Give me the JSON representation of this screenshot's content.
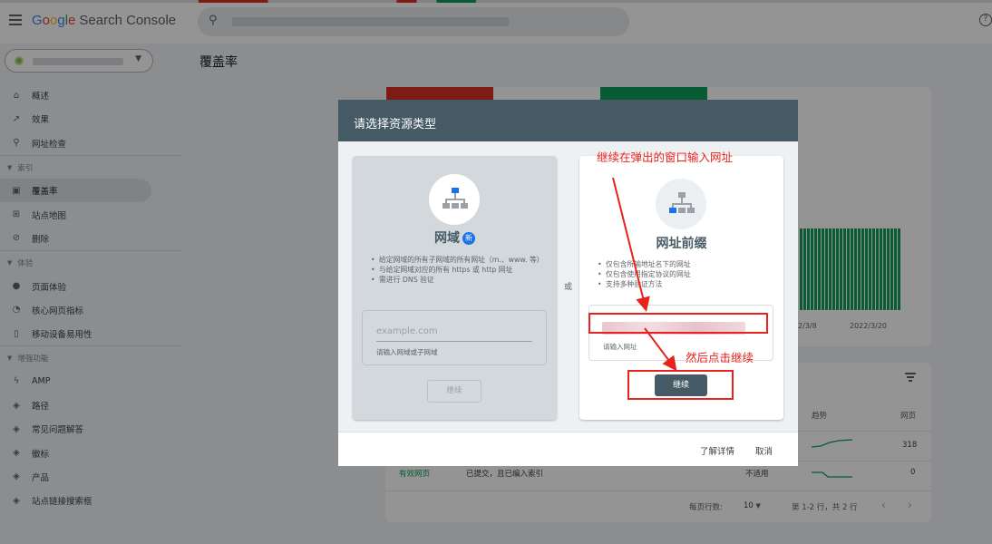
{
  "header": {
    "logo_letters": [
      {
        "ch": "G",
        "color": "#4285f4"
      },
      {
        "ch": "o",
        "color": "#ea4335"
      },
      {
        "ch": "o",
        "color": "#fbbc05"
      },
      {
        "ch": "g",
        "color": "#4285f4"
      },
      {
        "ch": "l",
        "color": "#34a853"
      },
      {
        "ch": "e",
        "color": "#ea4335"
      }
    ],
    "product": "Search Console",
    "help_glyph": "?"
  },
  "sidebar": {
    "caret": "▼",
    "items": [
      {
        "icon": "home-icon",
        "glyph": "⌂",
        "label": "概述"
      },
      {
        "icon": "trend-icon",
        "glyph": "↗",
        "label": "效果"
      },
      {
        "icon": "search-icon",
        "glyph": "⚲",
        "label": "网址检查"
      }
    ],
    "section_index": "索引",
    "index_items": [
      {
        "icon": "coverage-icon",
        "glyph": "▣",
        "label": "覆盖率",
        "active": true
      },
      {
        "icon": "sitemap-icon",
        "glyph": "⊞",
        "label": "站点地图"
      },
      {
        "icon": "removals-icon",
        "glyph": "⊘",
        "label": "删除"
      }
    ],
    "section_experience": "体验",
    "experience_items": [
      {
        "icon": "page-experience-icon",
        "glyph": "●",
        "label": "页面体验"
      },
      {
        "icon": "gauge-icon",
        "glyph": "◔",
        "label": "核心网页指标"
      },
      {
        "icon": "mobile-icon",
        "glyph": "▯",
        "label": "移动设备易用性"
      }
    ],
    "section_enhancements": "增强功能",
    "enhancement_items": [
      {
        "icon": "amp-icon",
        "glyph": "ϟ",
        "label": "AMP"
      },
      {
        "icon": "layers-icon",
        "glyph": "◈",
        "label": "路径"
      },
      {
        "icon": "layers-icon",
        "glyph": "◈",
        "label": "常见问题解答"
      },
      {
        "icon": "layers-icon",
        "glyph": "◈",
        "label": "徽标"
      },
      {
        "icon": "layers-icon",
        "glyph": "◈",
        "label": "产品"
      },
      {
        "icon": "layers-icon",
        "glyph": "◈",
        "label": "站点链接搜索框"
      }
    ]
  },
  "main": {
    "title": "覆盖率",
    "chart": {
      "dates": [
        "2/3/8",
        "2022/3/20"
      ]
    },
    "table": {
      "headers": [
        "趋势",
        "网页"
      ],
      "rows": [
        {
          "type": "",
          "source": "",
          "status": "",
          "pages": "318"
        },
        {
          "type": "有效网页",
          "source": "已提交，且已编入索引",
          "status": "不适用",
          "pages": "0"
        }
      ],
      "pagination": {
        "rows_per_page_label": "每页行数:",
        "rows_per_page": "10",
        "range": "第 1-2 行，共 2 行",
        "prev": "‹",
        "next": "›"
      }
    }
  },
  "dialog": {
    "title": "请选择资源类型",
    "or": "或",
    "domain": {
      "title": "网域",
      "badge": "新",
      "bullets": [
        "给定网域的所有子网域的所有网址（m.、www. 等）",
        "与给定网域对应的所有 https 或 http 网址",
        "需进行 DNS 验证"
      ],
      "placeholder": "example.com",
      "hint": "请输入网域或子网域",
      "button": "继续"
    },
    "prefix": {
      "title": "网址前缀",
      "bullets": [
        "仅包含所输地址名下的网址",
        "仅包含使用指定协议的网址",
        "支持多种验证方法"
      ],
      "hint": "请输入网址",
      "button": "继续"
    },
    "footer": {
      "learn_more": "了解详情",
      "cancel": "取消"
    }
  },
  "annotations": {
    "top": "继续在弹出的窗口输入网址",
    "bottom": "然后点击继续",
    "color": "#e8231d"
  }
}
